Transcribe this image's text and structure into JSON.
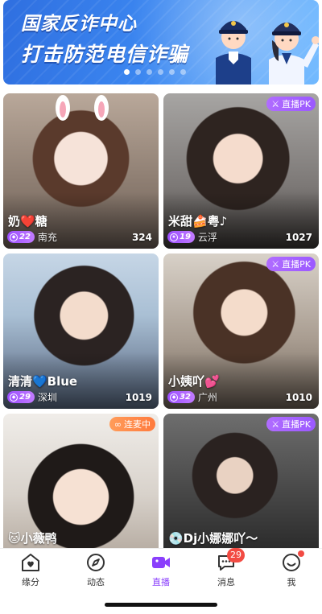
{
  "banner": {
    "line1": "国家反诈中心",
    "line2": "打击防范电信诈骗",
    "slide_count": 6,
    "active_slide": 0
  },
  "cards": [
    {
      "name": "奶❤️糖",
      "level": "22",
      "city": "南充",
      "viewers": "324",
      "tag": ""
    },
    {
      "name": "米甜🍰粤♪",
      "level": "19",
      "city": "云浮",
      "viewers": "1027",
      "tag": "直播PK"
    },
    {
      "name": "清清💙Blue",
      "level": "29",
      "city": "深圳",
      "viewers": "1019",
      "tag": ""
    },
    {
      "name": "小姨吖💕",
      "level": "32",
      "city": "广州",
      "viewers": "1010",
      "tag": "直播PK"
    },
    {
      "name": "🐱小薇鸭",
      "level": "",
      "city": "",
      "viewers": "",
      "tag": "连麦中"
    },
    {
      "name": "💿Dj小娜娜吖～",
      "level": "",
      "city": "",
      "viewers": "",
      "tag": "直播PK"
    }
  ],
  "tabbar": {
    "items": [
      {
        "label": "缘分",
        "icon": "heart-home-icon"
      },
      {
        "label": "动态",
        "icon": "compass-icon"
      },
      {
        "label": "直播",
        "icon": "video-camera-icon",
        "active": true
      },
      {
        "label": "消息",
        "icon": "chat-bubble-icon",
        "badge": "29"
      },
      {
        "label": "我",
        "icon": "smiley-icon",
        "dot": true
      }
    ]
  },
  "colors": {
    "accent": "#8a3ffc",
    "badge": "#f24b43",
    "pk_tag": "#a463ff",
    "mic_tag": "#ff8a48",
    "banner_blue": "#3b86f0"
  }
}
